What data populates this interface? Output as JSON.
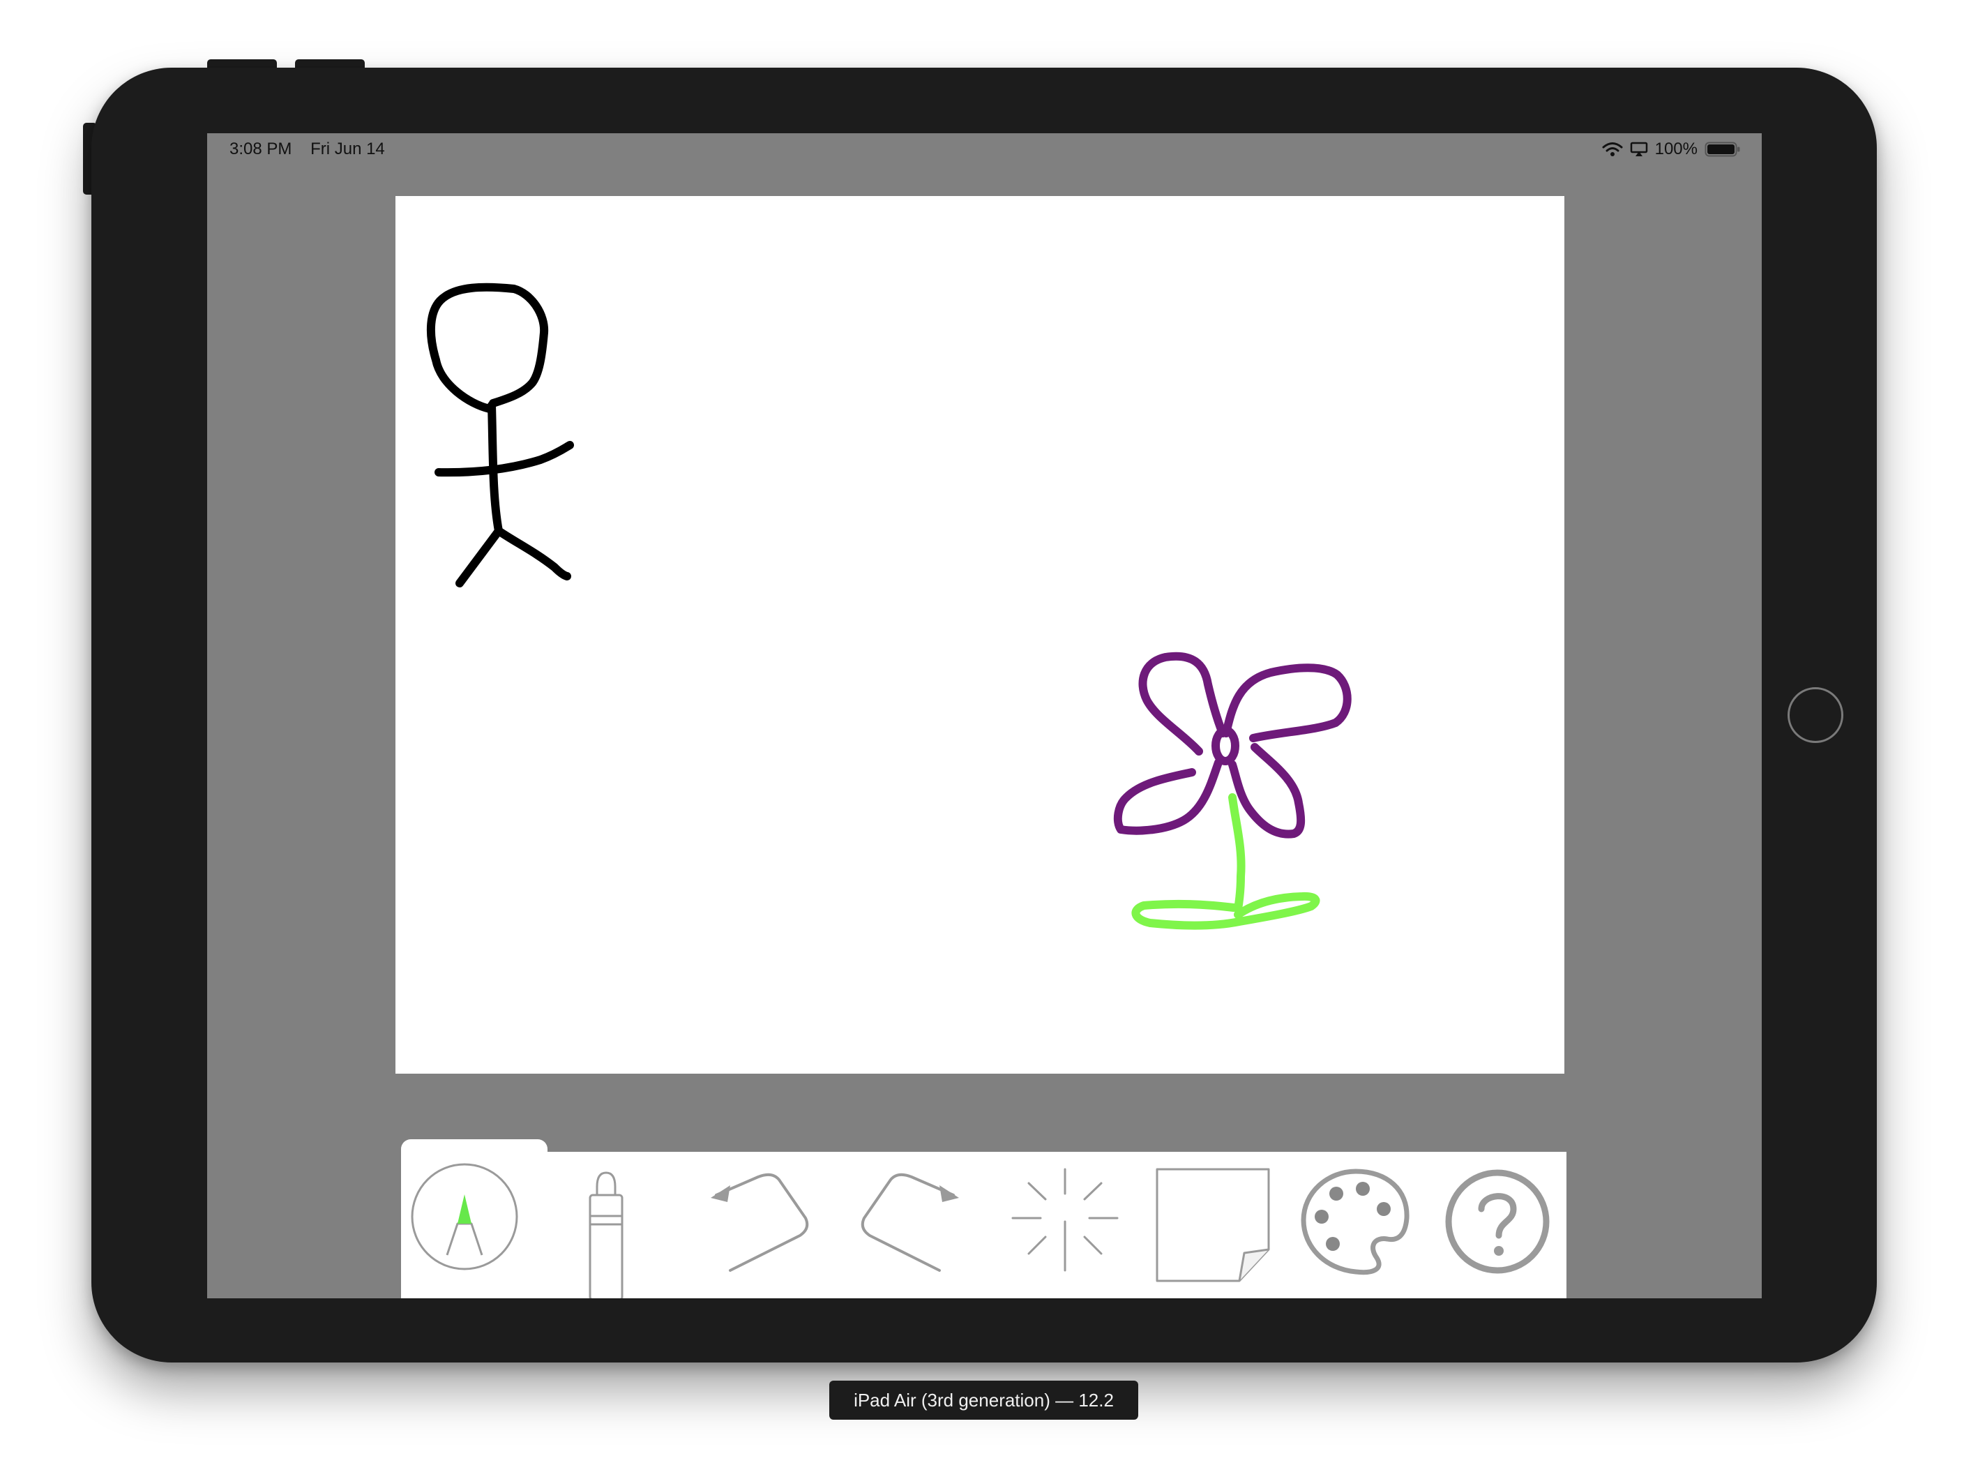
{
  "status_bar": {
    "time": "3:08 PM",
    "date": "Fri Jun 14",
    "battery_percent": "100%",
    "icons": [
      "wifi-icon",
      "airplay-icon",
      "battery-icon"
    ]
  },
  "canvas": {
    "background": "#ffffff",
    "drawings": [
      {
        "name": "stick-figure",
        "color": "#000000"
      },
      {
        "name": "flower-petals",
        "color": "#6e1a7a"
      },
      {
        "name": "flower-stem",
        "color": "#7ff54a"
      }
    ]
  },
  "toolbar": {
    "tools": [
      {
        "name": "pen",
        "icon": "pen-tool-icon",
        "selected": true
      },
      {
        "name": "eraser",
        "icon": "eraser-icon",
        "selected": false
      },
      {
        "name": "undo",
        "icon": "undo-icon",
        "selected": false
      },
      {
        "name": "redo",
        "icon": "redo-icon",
        "selected": false
      },
      {
        "name": "clear",
        "icon": "sparkle-clear-icon",
        "selected": false
      },
      {
        "name": "new-page",
        "icon": "blank-page-icon",
        "selected": false
      },
      {
        "name": "colors",
        "icon": "palette-icon",
        "selected": false
      },
      {
        "name": "help",
        "icon": "help-icon",
        "selected": false
      }
    ],
    "pen_tip_color": "#66e84a",
    "icon_color": "#9a9a9a"
  },
  "device": {
    "caption": "iPad Air (3rd generation) — 12.2"
  }
}
